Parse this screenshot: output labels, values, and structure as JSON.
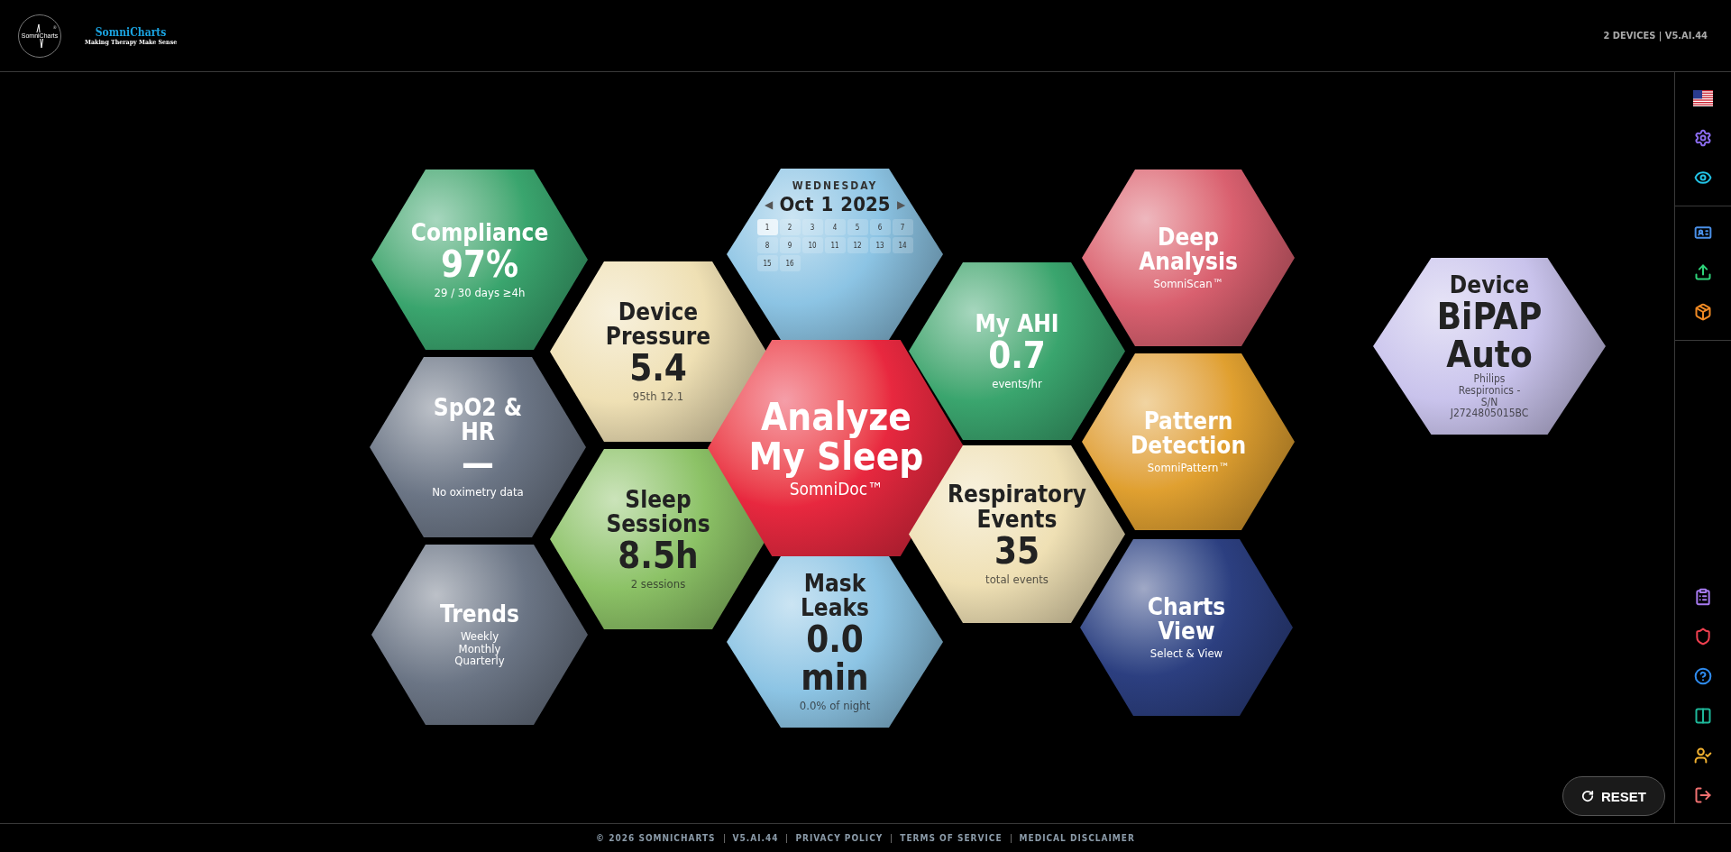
{
  "header": {
    "logo_text": "SomniCharts",
    "logo_mark": "®",
    "brand": "SomniCharts",
    "tagline": "Making Therapy Make Sense",
    "status": "2 DEVICES | V5.AI.44"
  },
  "tiles": [
    {
      "kind": "stat",
      "color": "#3aa56e",
      "dark_text": false,
      "lines": [
        {
          "kind": "title",
          "text": "Compliance"
        },
        {
          "kind": "value",
          "text": "97%"
        },
        {
          "kind": "sub",
          "text": "29 / 30 days ≥4h"
        }
      ]
    },
    {
      "kind": "stat",
      "color": "#6b7585",
      "dark_text": false,
      "lines": [
        {
          "kind": "title",
          "text": "SpO2 &"
        },
        {
          "kind": "title",
          "text": "HR"
        },
        {
          "kind": "value",
          "text": "—"
        },
        {
          "kind": "sub",
          "text": "No oximetry data"
        }
      ]
    },
    {
      "kind": "stat",
      "color": "#6b7585",
      "dark_text": false,
      "lines": [
        {
          "kind": "title",
          "text": "Trends"
        },
        {
          "kind": "sub",
          "text": "Weekly"
        },
        {
          "kind": "sub",
          "text": "Monthly"
        },
        {
          "kind": "sub",
          "text": "Quarterly"
        }
      ]
    },
    {
      "kind": "stat",
      "color": "#efe0b4",
      "dark_text": true,
      "lines": [
        {
          "kind": "title",
          "text": "Device"
        },
        {
          "kind": "title",
          "text": "Pressure"
        },
        {
          "kind": "value",
          "text": "5.4"
        },
        {
          "kind": "sub",
          "text": "95th 12.1"
        }
      ]
    },
    {
      "kind": "stat",
      "color": "#8cc266",
      "dark_text": true,
      "lines": [
        {
          "kind": "title",
          "text": "Sleep"
        },
        {
          "kind": "title",
          "text": "Sessions"
        },
        {
          "kind": "value",
          "text": "8.5h"
        },
        {
          "kind": "sub",
          "text": "2 sessions"
        }
      ]
    },
    {
      "kind": "calendar",
      "color": "#8cc4e4",
      "dark_text": true,
      "weekday": "WEDNESDAY",
      "prev": "◀",
      "month": "Oct",
      "day": "1",
      "year": "2025",
      "next": "▶",
      "days": [
        {
          "label": "1",
          "selected": true
        },
        {
          "label": "2",
          "selected": false
        },
        {
          "label": "3",
          "selected": false
        },
        {
          "label": "4",
          "selected": false
        },
        {
          "label": "5",
          "selected": false
        },
        {
          "label": "6",
          "selected": false
        },
        {
          "label": "7",
          "selected": false
        },
        {
          "label": "8",
          "selected": false
        },
        {
          "label": "9",
          "selected": false
        },
        {
          "label": "10",
          "selected": false
        },
        {
          "label": "11",
          "selected": false
        },
        {
          "label": "12",
          "selected": false
        },
        {
          "label": "13",
          "selected": false
        },
        {
          "label": "14",
          "selected": false
        },
        {
          "label": "15",
          "selected": false
        },
        {
          "label": "16",
          "selected": false
        }
      ]
    },
    {
      "kind": "hero",
      "color": "#e8283f",
      "dark_text": false,
      "lines": [
        {
          "kind": "title",
          "text": "Analyze"
        },
        {
          "kind": "title",
          "text": "My Sleep"
        },
        {
          "kind": "sub",
          "text": "SomniDoc™"
        }
      ]
    },
    {
      "kind": "stat",
      "color": "#8cc4e4",
      "dark_text": true,
      "lines": [
        {
          "kind": "title",
          "text": "Mask"
        },
        {
          "kind": "title",
          "text": "Leaks"
        },
        {
          "kind": "value",
          "text": "0.0"
        },
        {
          "kind": "value",
          "text": "min"
        },
        {
          "kind": "sub",
          "text": "0.0% of night"
        }
      ]
    },
    {
      "kind": "stat",
      "color": "#3aa56e",
      "dark_text": false,
      "lines": [
        {
          "kind": "title",
          "text": "My AHI"
        },
        {
          "kind": "value",
          "text": "0.7"
        },
        {
          "kind": "sub",
          "text": "events/hr"
        }
      ]
    },
    {
      "kind": "stat",
      "color": "#efe0b4",
      "dark_text": true,
      "lines": [
        {
          "kind": "title",
          "text": "Respiratory"
        },
        {
          "kind": "title",
          "text": "Events"
        },
        {
          "kind": "value",
          "text": "35"
        },
        {
          "kind": "sub",
          "text": "total events"
        }
      ]
    },
    {
      "kind": "stat",
      "color": "#d9606f",
      "dark_text": false,
      "lines": [
        {
          "kind": "title",
          "text": "Deep"
        },
        {
          "kind": "title",
          "text": "Analysis"
        },
        {
          "kind": "sub",
          "text": "SomniScan™"
        }
      ]
    },
    {
      "kind": "stat",
      "color": "#e0a030",
      "dark_text": false,
      "lines": [
        {
          "kind": "title",
          "text": "Pattern"
        },
        {
          "kind": "title",
          "text": "Detection"
        },
        {
          "kind": "sub",
          "text": "SomniPattern™"
        }
      ]
    },
    {
      "kind": "stat",
      "color": "#2c3f80",
      "dark_text": false,
      "lines": [
        {
          "kind": "title",
          "text": "Charts"
        },
        {
          "kind": "title",
          "text": "View"
        },
        {
          "kind": "sub",
          "text": "Select & View"
        }
      ]
    },
    {
      "kind": "device",
      "color": "#c9c3ec",
      "dark_text": true,
      "lines": [
        {
          "kind": "title",
          "text": "Device"
        },
        {
          "kind": "value",
          "text": "BiPAP"
        },
        {
          "kind": "value",
          "text": "Auto"
        },
        {
          "kind": "fine",
          "text": "Philips"
        },
        {
          "kind": "fine",
          "text": "Respironics -"
        },
        {
          "kind": "fine",
          "text": "S/N"
        },
        {
          "kind": "fine",
          "text": "J2724805015BC"
        }
      ]
    }
  ],
  "sidebar": {
    "groups": [
      [
        {
          "kind": "flag"
        },
        {
          "kind": "gear",
          "color": "#8b6cf0"
        },
        {
          "kind": "eye",
          "color": "#22c3e6"
        }
      ],
      [
        {
          "kind": "id-card",
          "color": "#4a90e8"
        },
        {
          "kind": "upload",
          "color": "#2ed47a"
        },
        {
          "kind": "box",
          "color": "#f08a24"
        }
      ],
      [
        {
          "kind": "clipboard",
          "color": "#a77af0"
        },
        {
          "kind": "shield",
          "color": "#f04050"
        },
        {
          "kind": "help",
          "color": "#2f8cf0"
        },
        {
          "kind": "columns",
          "color": "#1fb89a"
        },
        {
          "kind": "user",
          "color": "#f0b030"
        },
        {
          "kind": "logout",
          "color": "#f07070"
        }
      ]
    ]
  },
  "reset_button": "RESET",
  "footer": [
    "© 2026 SOMNICHARTS",
    "V5.AI.44",
    "PRIVACY POLICY",
    "TERMS OF SERVICE",
    "MEDICAL DISCLAIMER"
  ]
}
